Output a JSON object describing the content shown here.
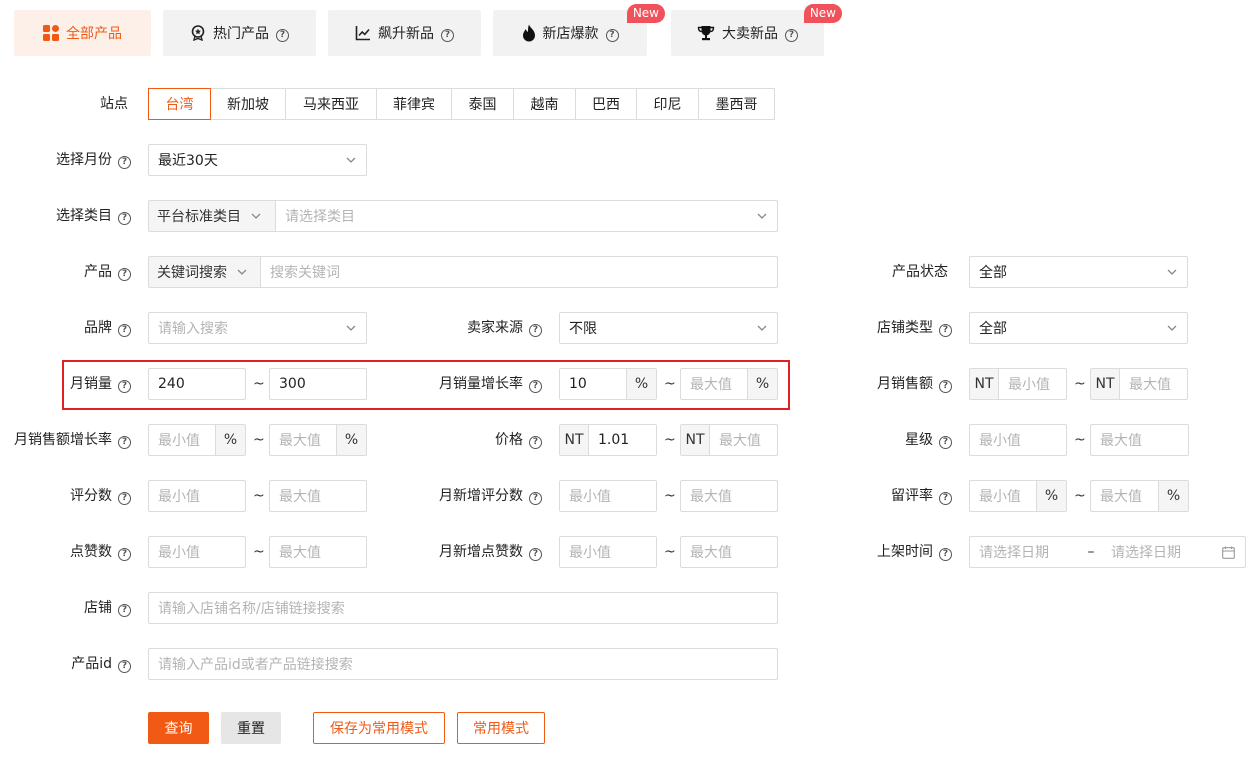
{
  "tabs": [
    {
      "label": "全部产品",
      "icon": "grid-icon",
      "help": false,
      "badge": ""
    },
    {
      "label": "热门产品",
      "icon": "medal-icon",
      "help": true,
      "badge": ""
    },
    {
      "label": "飙升新品",
      "icon": "trend-chart-icon",
      "help": true,
      "badge": ""
    },
    {
      "label": "新店爆款",
      "icon": "flame-icon",
      "help": true,
      "badge": "New"
    },
    {
      "label": "大卖新品",
      "icon": "trophy-icon",
      "help": true,
      "badge": "New"
    }
  ],
  "help_mark": "?",
  "station": {
    "label": "站点",
    "options": [
      "台湾",
      "新加坡",
      "马来西亚",
      "菲律宾",
      "泰国",
      "越南",
      "巴西",
      "印尼",
      "墨西哥"
    ],
    "selected": "台湾"
  },
  "month": {
    "label": "选择月份",
    "value": "最近30天"
  },
  "category": {
    "label": "选择类目",
    "type_value": "平台标准类目",
    "placeholder": "请选择类目"
  },
  "product": {
    "label": "产品",
    "mode_value": "关键词搜索",
    "placeholder": "搜索关键词"
  },
  "product_status": {
    "label": "产品状态",
    "value": "全部"
  },
  "brand": {
    "label": "品牌",
    "placeholder": "请输入搜索"
  },
  "seller_source": {
    "label": "卖家来源",
    "value": "不限"
  },
  "shop_type": {
    "label": "店铺类型",
    "value": "全部"
  },
  "monthly_sales": {
    "label": "月销量",
    "min": "240",
    "max": "300"
  },
  "sales_growth": {
    "label": "月销量增长率",
    "min": "10",
    "max_placeholder": "最大值",
    "unit": "%"
  },
  "monthly_revenue": {
    "label": "月销售额",
    "currency": "NT",
    "min_placeholder": "最小值",
    "max_placeholder": "最大值"
  },
  "revenue_growth": {
    "label": "月销售额增长率",
    "min_placeholder": "最小值",
    "max_placeholder": "最大值",
    "unit": "%"
  },
  "price": {
    "label": "价格",
    "currency": "NT",
    "min": "1.01",
    "max_placeholder": "最大值"
  },
  "star_rating": {
    "label": "星级",
    "min_placeholder": "最小值",
    "max_placeholder": "最大值"
  },
  "rating_count": {
    "label": "评分数",
    "min_placeholder": "最小值",
    "max_placeholder": "最大值"
  },
  "monthly_new_ratings": {
    "label": "月新增评分数",
    "min_placeholder": "最小值",
    "max_placeholder": "最大值"
  },
  "review_rate": {
    "label": "留评率",
    "min_placeholder": "最小值",
    "max_placeholder": "最大值",
    "unit": "%"
  },
  "likes": {
    "label": "点赞数",
    "min_placeholder": "最小值",
    "max_placeholder": "最大值"
  },
  "monthly_new_likes": {
    "label": "月新增点赞数",
    "min_placeholder": "最小值",
    "max_placeholder": "最大值"
  },
  "listing_time": {
    "label": "上架时间",
    "start_placeholder": "请选择日期",
    "sep": "–",
    "end_placeholder": "请选择日期"
  },
  "shop": {
    "label": "店铺",
    "placeholder": "请输入店铺名称/店铺链接搜索"
  },
  "product_id": {
    "label": "产品id",
    "placeholder": "请输入产品id或者产品链接搜索"
  },
  "tilde": "~",
  "buttons": {
    "query": "查询",
    "reset": "重置",
    "save_mode": "保存为常用模式",
    "common_mode": "常用模式"
  },
  "colors": {
    "accent": "#f05a14",
    "highlight": "#e02020",
    "badge": "#f0515a"
  }
}
